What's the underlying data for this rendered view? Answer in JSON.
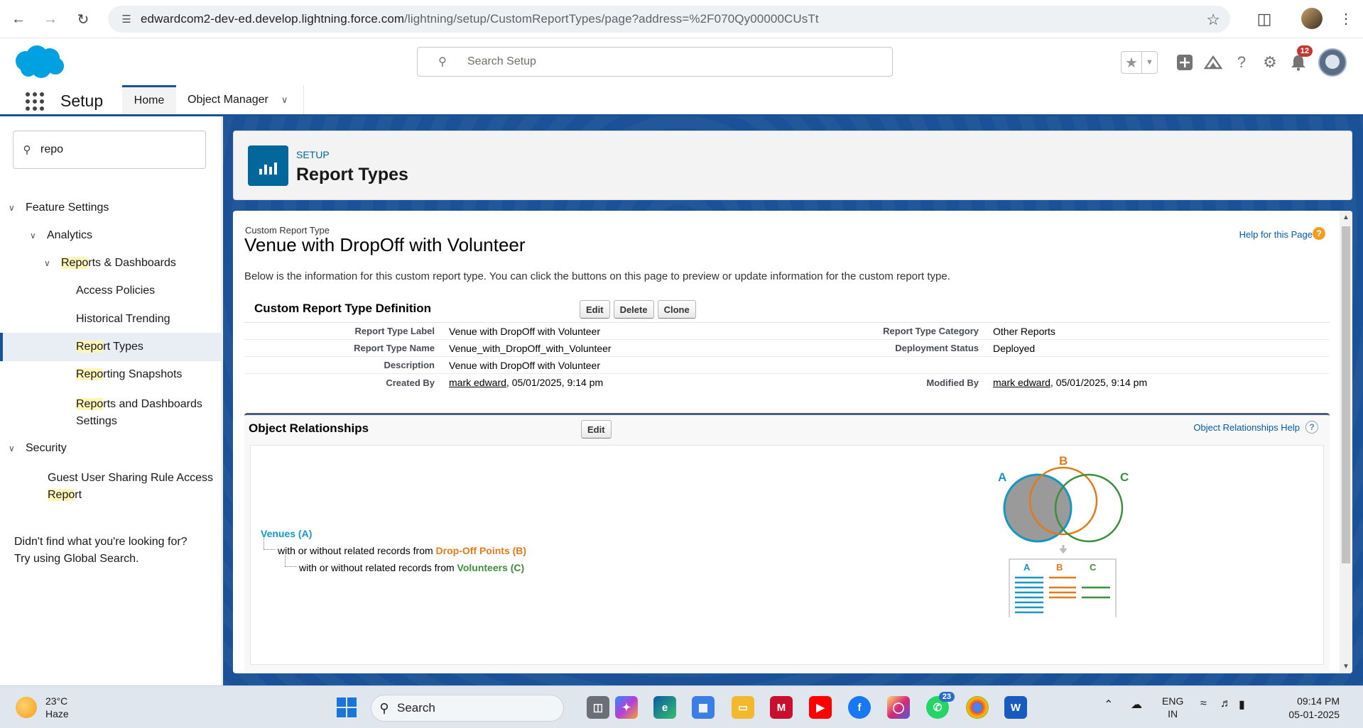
{
  "browser": {
    "url_host": "edwardcom2-dev-ed.develop.lightning.force.com",
    "url_path": "/lightning/setup/CustomReportTypes/page?address=%2F070Qy00000CUsTt"
  },
  "header": {
    "search_placeholder": "Search Setup",
    "notification_count": "12"
  },
  "app_nav": {
    "app_name": "Setup",
    "tabs": [
      {
        "label": "Home"
      },
      {
        "label": "Object Manager"
      }
    ]
  },
  "sidebar": {
    "quickfind_value": "repo",
    "items": {
      "feature_settings": "Feature Settings",
      "analytics": "Analytics",
      "reports_dashboards_hl": "Repo",
      "reports_dashboards_rest": "rts & Dashboards",
      "access_policies": "Access Policies",
      "historical_trending": "Historical Trending",
      "report_types_hl": "Repo",
      "report_types_rest": "rt Types",
      "reporting_snapshots_hl": "Repo",
      "reporting_snapshots_rest": "rting Snapshots",
      "rds_settings_hl": "Repo",
      "rds_settings_rest": "rts and Dashboards",
      "rds_settings_line2": "Settings",
      "security": "Security",
      "guest_user_line1": "Guest User Sharing Rule Access",
      "guest_user_hl": "Repo",
      "guest_user_rest": "rt"
    },
    "not_found_line1": "Didn't find what you're looking for?",
    "not_found_line2": "Try using Global Search."
  },
  "page_header": {
    "label": "SETUP",
    "title": "Report Types"
  },
  "report_type": {
    "subtitle": "Custom Report Type",
    "title": "Venue with DropOff with Volunteer",
    "help_link": "Help for this Page",
    "intro": "Below is the information for this custom report type. You can click the buttons on this page to preview or update information for the custom report type.",
    "definition_heading": "Custom Report Type Definition",
    "buttons": {
      "edit": "Edit",
      "delete": "Delete",
      "clone": "Clone"
    },
    "fields": {
      "label_label": "Report Type Label",
      "label_value": "Venue with DropOff with Volunteer",
      "name_label": "Report Type Name",
      "name_value": "Venue_with_DropOff_with_Volunteer",
      "description_label": "Description",
      "description_value": "Venue with DropOff with Volunteer",
      "created_label": "Created By",
      "created_user": "mark edward",
      "created_date": ", 05/01/2025, 9:14 pm",
      "category_label": "Report Type Category",
      "category_value": "Other Reports",
      "status_label": "Deployment Status",
      "status_value": "Deployed",
      "modified_label": "Modified By",
      "modified_user": "mark edward",
      "modified_date": ", 05/01/2025, 9:14 pm"
    }
  },
  "relationships": {
    "heading": "Object Relationships",
    "edit_label": "Edit",
    "help_link": "Object Relationships Help",
    "object_a": "Venues (A)",
    "line1_prefix": "with or without related records from ",
    "object_b": "Drop-Off Points (B)",
    "line2_prefix": "with or without related records from ",
    "object_c": "Volunteers (C)",
    "venn": {
      "a": "A",
      "b": "B",
      "c": "C",
      "color_a": "#1797c0",
      "color_b": "#e07b19",
      "color_c": "#3e8e3e"
    }
  },
  "taskbar": {
    "temperature": "23°C",
    "weather": "Haze",
    "search_label": "Search",
    "whatsapp_badge": "23",
    "lang_line1": "ENG",
    "lang_line2": "IN",
    "time": "09:14 PM",
    "date": "05-01-2025"
  }
}
